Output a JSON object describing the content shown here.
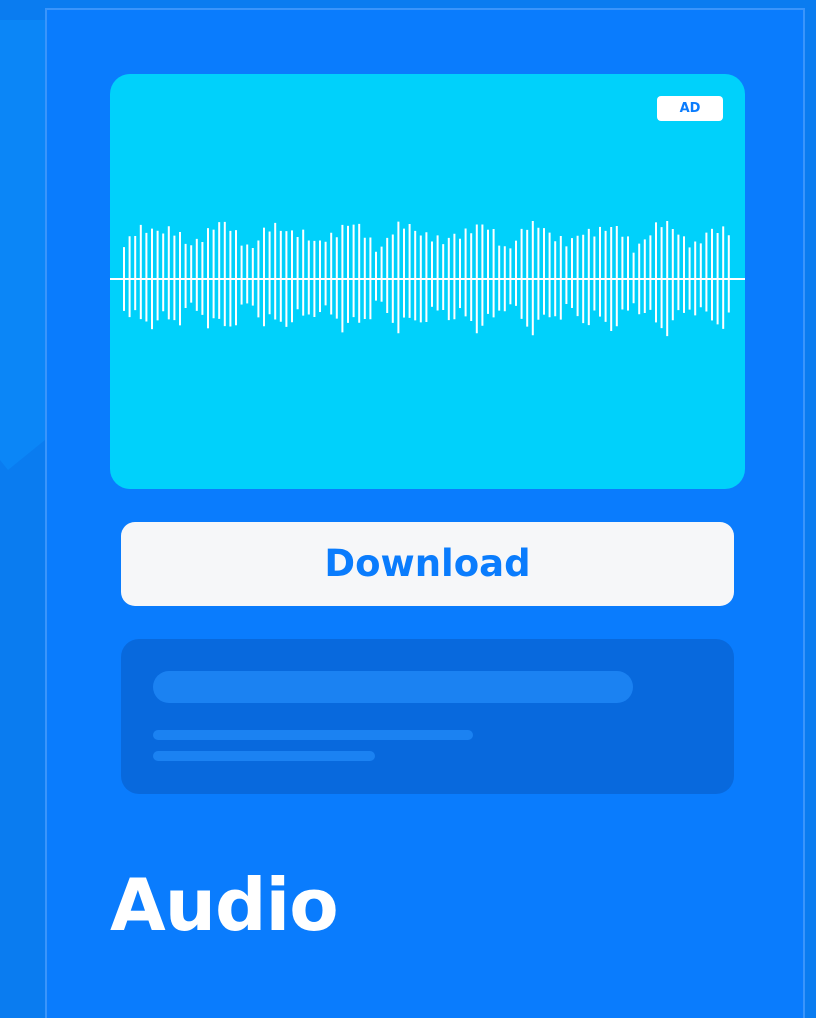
{
  "card": {
    "badge": "AD",
    "download_label": "Download",
    "title": "Audio"
  },
  "colors": {
    "background": "#0a7cf0",
    "card": "#0a7cfd",
    "media": "#00d1fb",
    "accent": "#0a7cfd",
    "button": "#f6f7f9",
    "skeleton": "#0869dd",
    "skeleton_line": "#1b82f2"
  },
  "icons": {
    "media": "audio-waveform-icon"
  }
}
